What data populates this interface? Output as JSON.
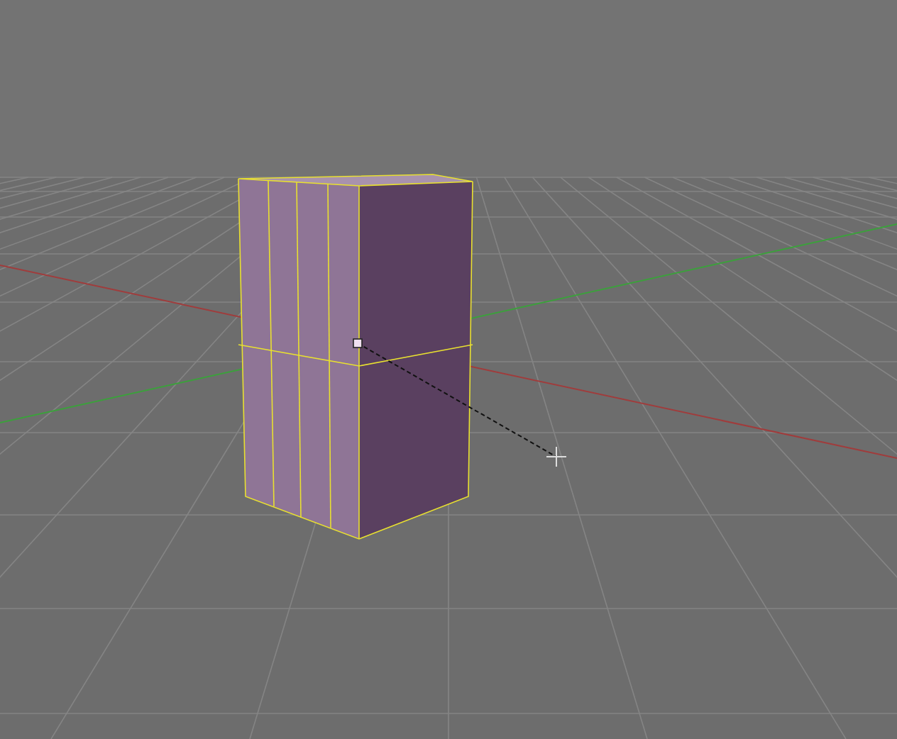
{
  "viewport": {
    "mesh": {
      "selected": true
    }
  }
}
